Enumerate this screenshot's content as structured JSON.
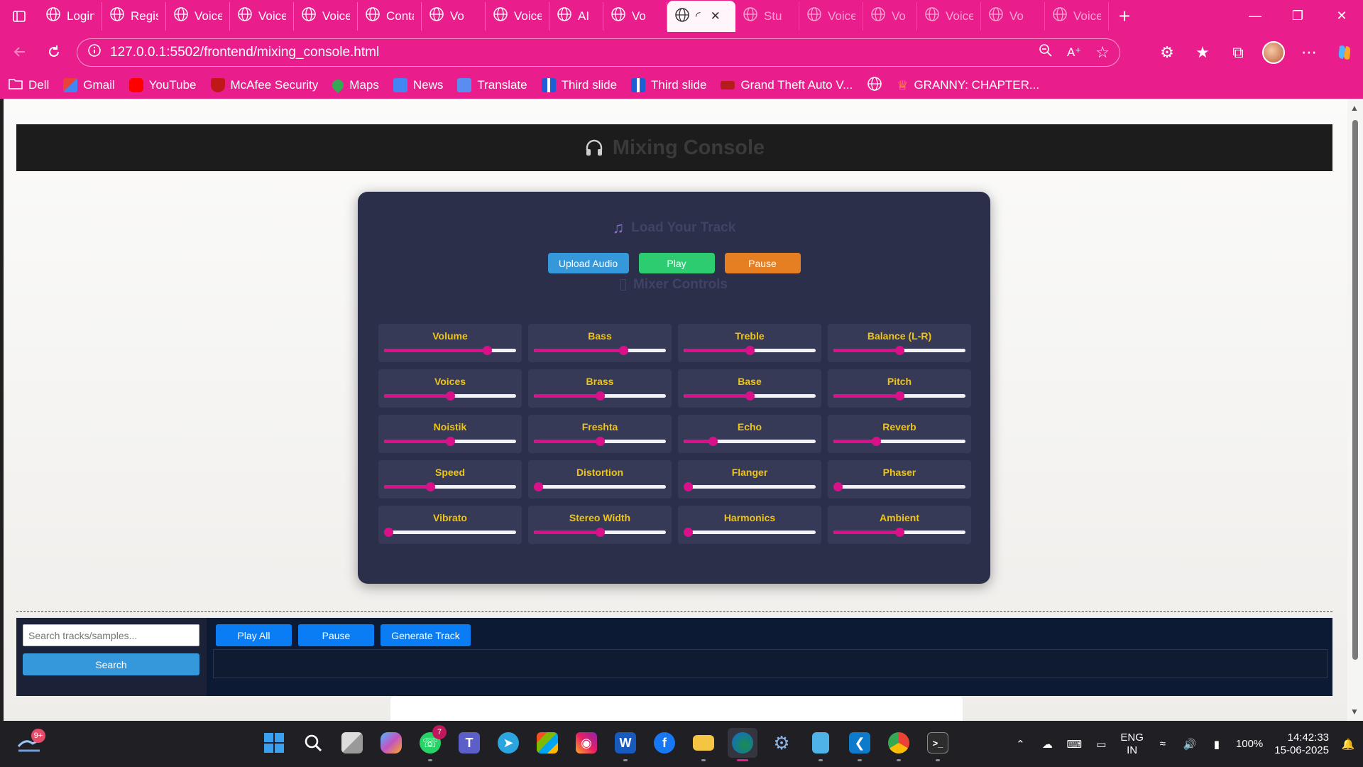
{
  "browser": {
    "tabs": [
      {
        "title": "Login",
        "active": false
      },
      {
        "title": "Regist",
        "active": false
      },
      {
        "title": "VoiceC",
        "active": false
      },
      {
        "title": "VoiceC",
        "active": false
      },
      {
        "title": "VoiceC",
        "active": false
      },
      {
        "title": "Conta",
        "active": false
      },
      {
        "title": "Vo",
        "active": false
      },
      {
        "title": "VoiceT",
        "active": false
      },
      {
        "title": "AI",
        "active": false
      },
      {
        "title": "Vo",
        "active": false
      },
      {
        "title": "",
        "active": true
      },
      {
        "title": "Stu",
        "active": false
      },
      {
        "title": "VoiceC",
        "active": false
      },
      {
        "title": "Vo",
        "active": false
      },
      {
        "title": "Voice",
        "active": false
      },
      {
        "title": "Vo",
        "active": false
      },
      {
        "title": "VoiceC",
        "active": false
      }
    ],
    "url": "127.0.0.1:5502/frontend/mixing_console.html",
    "bookmarks": [
      "Dell",
      "Gmail",
      "YouTube",
      "McAfee Security",
      "Maps",
      "News",
      "Translate",
      "Third slide",
      "Third slide",
      "Grand Theft Auto V...",
      "",
      "GRANNY: CHAPTER..."
    ]
  },
  "page": {
    "header_title": "Mixing Console",
    "load_title": "Load Your Track",
    "mixer_title": "Mixer Controls",
    "buttons": {
      "upload": "Upload Audio",
      "play": "Play",
      "pause": "Pause"
    },
    "controls": [
      {
        "label": "Volume",
        "value": 0.78
      },
      {
        "label": "Bass",
        "value": 0.68
      },
      {
        "label": "Treble",
        "value": 0.5
      },
      {
        "label": "Balance (L-R)",
        "value": 0.5
      },
      {
        "label": "Voices",
        "value": 0.5
      },
      {
        "label": "Brass",
        "value": 0.5
      },
      {
        "label": "Base",
        "value": 0.5
      },
      {
        "label": "Pitch",
        "value": 0.5
      },
      {
        "label": "Noistik",
        "value": 0.5
      },
      {
        "label": "Freshta",
        "value": 0.5
      },
      {
        "label": "Echo",
        "value": 0.22
      },
      {
        "label": "Reverb",
        "value": 0.32
      },
      {
        "label": "Speed",
        "value": 0.35
      },
      {
        "label": "Distortion",
        "value": 0.03
      },
      {
        "label": "Flanger",
        "value": 0.03
      },
      {
        "label": "Phaser",
        "value": 0.03
      },
      {
        "label": "Vibrato",
        "value": 0.03
      },
      {
        "label": "Stereo Width",
        "value": 0.5
      },
      {
        "label": "Harmonics",
        "value": 0.03
      },
      {
        "label": "Ambient",
        "value": 0.5
      }
    ],
    "player": {
      "search_placeholder": "Search tracks/samples...",
      "search_button": "Search",
      "play_all": "Play All",
      "pause": "Pause",
      "generate": "Generate Track"
    }
  },
  "taskbar": {
    "notification_count": "9+",
    "whatsapp_badge": "7",
    "lang_line1": "ENG",
    "lang_line2": "IN",
    "battery": "100%",
    "time": "14:42:33",
    "date": "15-06-2025"
  },
  "colors": {
    "brand": "#e91e8c",
    "console_bg": "#2c2f4a",
    "label": "#f1c40f",
    "slider": "#d9108a"
  }
}
